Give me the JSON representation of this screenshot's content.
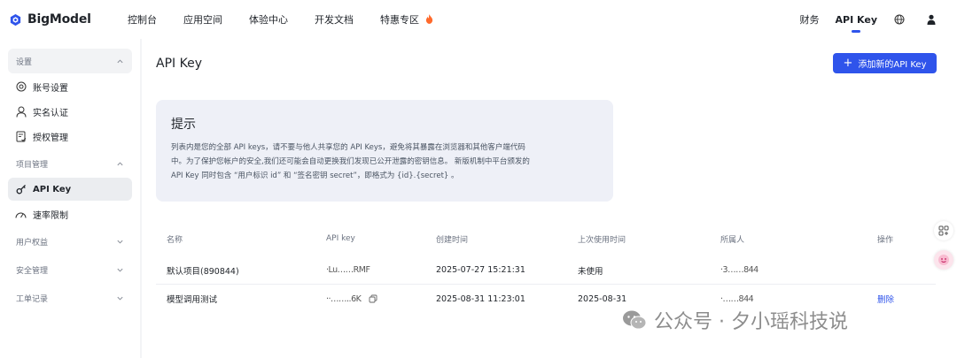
{
  "brand": {
    "name": "BigModel"
  },
  "nav": {
    "items": [
      "控制台",
      "应用空间",
      "体验中心",
      "开发文档",
      "特惠专区"
    ],
    "promo_icon": "fire-icon",
    "right": {
      "finance": "财务",
      "api_key": "API Key"
    },
    "accent_color": "#2f54eb"
  },
  "sidebar": {
    "settings_group": "设置",
    "account_settings": "账号设置",
    "real_name": "实名认证",
    "authorization": "授权管理",
    "project_group": "项目管理",
    "api_key": "API Key",
    "rate_limit": "速率限制",
    "user_rights": "用户权益",
    "security": "安全管理",
    "tickets": "工单记录"
  },
  "main": {
    "title": "API Key",
    "add_button": "添加新的API Key",
    "tip": {
      "title": "提示",
      "line1": "列表内是您的全部 API keys，请不要与他人共享您的 API Keys，避免将其暴露在浏览器和其他客户端代码",
      "line2": "中。为了保护您帐户的安全,我们还可能会自动更换我们发现已公开泄露的密钥信息。 新版机制中平台颁发的",
      "line3": "API Key 同时包含 “用户标识 id” 和 “签名密钥 secret”，即格式为 {id}.{secret} 。"
    },
    "table": {
      "headers": {
        "name": "名称",
        "key": "API key",
        "created": "创建时间",
        "last_used": "上次使用时间",
        "owner": "所属人",
        "actions": "操作"
      },
      "rows": [
        {
          "name": "默认项目(890844)",
          "key": "·Lu……RMF",
          "created": "2025-07-27 15:21:31",
          "last_used": "未使用",
          "owner": "·3……844",
          "action": ""
        },
        {
          "name": "模型调用测试",
          "key": "··……..6K",
          "created": "2025-08-31 11:23:01",
          "last_used": "2025-08-31",
          "owner": "·……844",
          "action": "删除"
        }
      ]
    }
  },
  "watermark": {
    "text": "公众号 · 夕小瑶科技说"
  }
}
